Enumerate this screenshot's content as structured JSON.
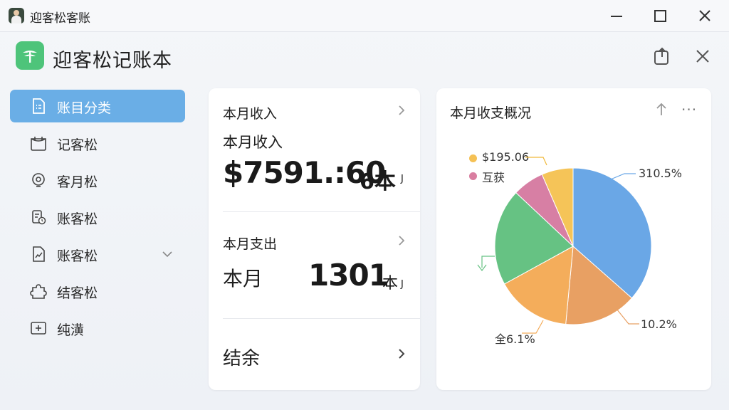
{
  "window": {
    "title": "迎客松客账",
    "controls": [
      "minimize",
      "maximize",
      "close"
    ]
  },
  "app": {
    "name": "迎客松记账本",
    "header_actions": [
      "share-icon",
      "close-icon"
    ]
  },
  "sidebar": {
    "items": [
      {
        "label": "账目分类",
        "icon": "document-icon",
        "active": true
      },
      {
        "label": "记客松",
        "icon": "box-icon",
        "active": false
      },
      {
        "label": "客月松",
        "icon": "lightbulb-icon",
        "active": false
      },
      {
        "label": "账客松",
        "icon": "clipboard-clock-icon",
        "active": false
      },
      {
        "label": "账客松",
        "icon": "report-icon",
        "active": false,
        "expandable": true
      },
      {
        "label": "结客松",
        "icon": "puzzle-icon",
        "active": false
      },
      {
        "label": "纯潢",
        "icon": "plus-box-icon",
        "active": false
      }
    ]
  },
  "summary": {
    "income": {
      "section_title": "本月收入",
      "label": "本月收入",
      "amount": "$7591.:60",
      "suffix": "6本",
      "suffix_mark": "J"
    },
    "expense": {
      "section_title": "本月支出",
      "label": "本月",
      "amount": "1301",
      "suffix": "本",
      "suffix_mark": "J"
    },
    "balance": {
      "section_title": "结余"
    }
  },
  "overview": {
    "title": "本月收支概况",
    "more": "···",
    "legend": [
      {
        "label": "$195.06",
        "color": "#f5c155"
      },
      {
        "label": "互获",
        "color": "#d97ea0"
      }
    ],
    "labels": {
      "top_right": "310.5%",
      "bottom_right": "10.2%",
      "bottom_left": "全6.1%"
    }
  },
  "chart_data": {
    "type": "pie",
    "title": "本月收支概况",
    "slices": [
      {
        "value": 36.5,
        "color": "#6aa7e6"
      },
      {
        "value": 15.0,
        "color": "#e8a063"
      },
      {
        "value": 15.5,
        "color": "#f4ad5b"
      },
      {
        "value": 20.0,
        "color": "#66c283"
      },
      {
        "value": 6.5,
        "color": "#d77fa4"
      },
      {
        "value": 6.5,
        "color": "#f5c458"
      }
    ],
    "start_angle_deg": -90
  }
}
